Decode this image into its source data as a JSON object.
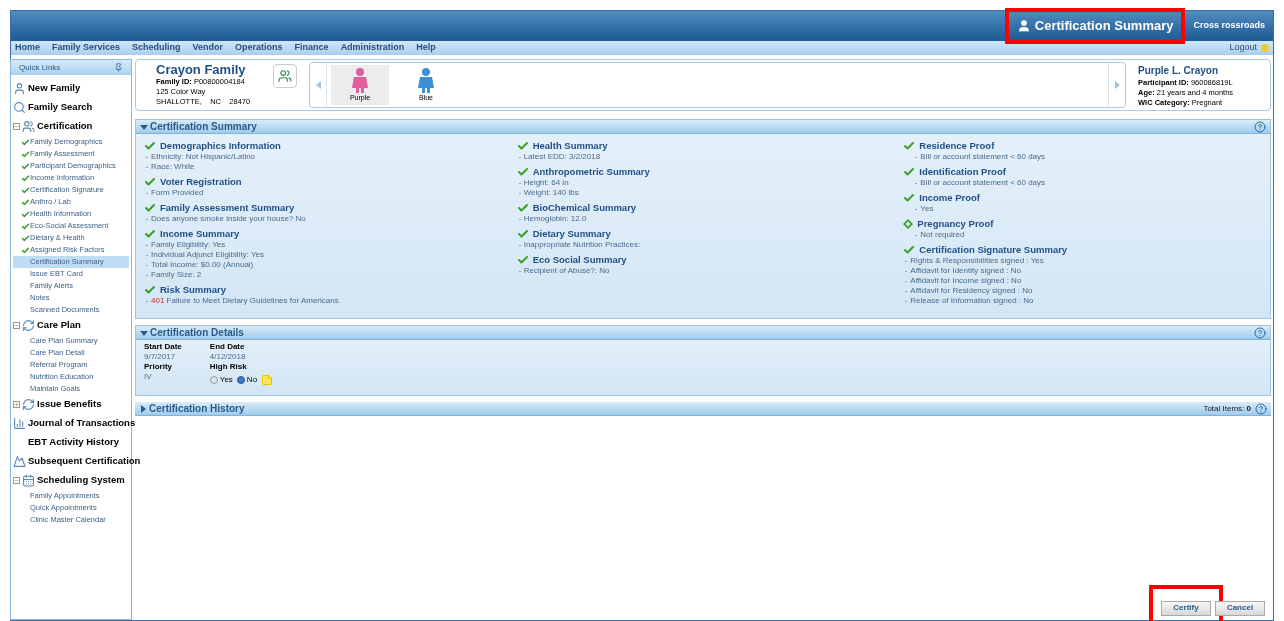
{
  "header": {
    "title": "Certification Summary",
    "highlighted": true,
    "location": "Cross rossroads"
  },
  "menu": [
    "Home",
    "Family Services",
    "Scheduling",
    "Vendor",
    "Operations",
    "Finance",
    "Administration",
    "Help"
  ],
  "logout": "Logout",
  "sidebar": {
    "title": "Quick Links",
    "items": [
      {
        "kind": "link",
        "label": "New Family"
      },
      {
        "kind": "link",
        "label": "Family Search"
      },
      {
        "kind": "section",
        "label": "Certification",
        "expanded": true,
        "children": [
          {
            "label": "Family Demographics",
            "done": true,
            "selected": false
          },
          {
            "label": "Family Assessment",
            "done": true,
            "selected": false
          },
          {
            "label": "Participant Demographics",
            "done": true,
            "selected": false
          },
          {
            "label": "Income Information",
            "done": true,
            "selected": false
          },
          {
            "label": "Certification Signature",
            "done": true,
            "selected": false
          },
          {
            "label": "Anthro / Lab",
            "done": true,
            "selected": false
          },
          {
            "label": "Health Information",
            "done": true,
            "selected": false
          },
          {
            "label": "Eco-Social Assessment",
            "done": true,
            "selected": false
          },
          {
            "label": "Dietary & Health",
            "done": true,
            "selected": false
          },
          {
            "label": "Assigned Risk Factors",
            "done": true,
            "selected": false
          },
          {
            "label": "Certification Summary",
            "done": false,
            "selected": true
          },
          {
            "label": "Issue EBT Card",
            "done": false,
            "selected": false
          },
          {
            "label": "Family Alerts",
            "done": false,
            "selected": false
          },
          {
            "label": "Notes",
            "done": false,
            "selected": false
          },
          {
            "label": "Scanned Documents",
            "done": false,
            "selected": false
          }
        ]
      },
      {
        "kind": "section",
        "label": "Care Plan",
        "expanded": true,
        "children": [
          {
            "label": "Care Plan Summary",
            "done": false,
            "selected": false
          },
          {
            "label": "Care Plan Detail",
            "done": false,
            "selected": false
          },
          {
            "label": "Referral Program",
            "done": false,
            "selected": false
          },
          {
            "label": "Nutrition Education",
            "done": false,
            "selected": false
          },
          {
            "label": "Maintain Goals",
            "done": false,
            "selected": false
          }
        ]
      },
      {
        "kind": "section",
        "label": "Issue Benefits",
        "expanded": false
      },
      {
        "kind": "link",
        "label": "Journal of Transactions"
      },
      {
        "kind": "link",
        "label": "EBT Activity History"
      },
      {
        "kind": "link",
        "label": "Subsequent Certification"
      },
      {
        "kind": "section",
        "label": "Scheduling System",
        "expanded": true,
        "children": [
          {
            "label": "Family Appointments",
            "done": false,
            "selected": false
          },
          {
            "label": "Quick Appointments",
            "done": false,
            "selected": false
          },
          {
            "label": "Clinic Master Calendar",
            "done": false,
            "selected": false
          }
        ]
      }
    ]
  },
  "family": {
    "name": "Crayon Family",
    "id_label": "Family ID:",
    "id": "P00800004184",
    "address": [
      "125 Color Way",
      "SHALLOTTE,    NC    28470"
    ]
  },
  "participants": [
    {
      "name": "Purple",
      "color": "#e35d9c",
      "selected": true
    },
    {
      "name": "Blue",
      "color": "#3a8fd6",
      "selected": false
    }
  ],
  "participant": {
    "name": "Purple L. Crayon",
    "fields": [
      {
        "label": "Participant ID:",
        "value": "960086819L"
      },
      {
        "label": "Age:",
        "value": "21 years and 4 months"
      },
      {
        "label": "WIC Category:",
        "value": "Pregnant"
      }
    ]
  },
  "summary": {
    "title": "Certification Summary",
    "expanded": true,
    "columns": [
      [
        {
          "title": "Demographics Information",
          "done": true,
          "lines": [
            "Ethnicity: Not Hispanic/Latino",
            "Race: White"
          ]
        },
        {
          "title": "Voter Registration",
          "done": true,
          "lines": [
            "Form Provided"
          ]
        },
        {
          "title": "Family Assessment Summary",
          "done": true,
          "lines": [
            "Does anyone smoke inside your house? No"
          ]
        },
        {
          "title": "Income Summary",
          "done": true,
          "lines": [
            "Family Eligibility: Yes",
            "Individual Adjunct Eligibility: Yes",
            "Total Income: $0.00 (Annual)",
            "Family Size: 2"
          ]
        },
        {
          "title": "Risk Summary",
          "done": true,
          "lines": [
            {
              "code": "401",
              "text": "Failure to Meet Dietary Guidelines for Americans"
            }
          ]
        }
      ],
      [
        {
          "title": "Health Summary",
          "done": true,
          "lines": [
            "Latest EDD: 3/2/2018"
          ]
        },
        {
          "title": "Anthropometric Summary",
          "done": true,
          "lines": [
            "Height: 64 in",
            "Weight: 140 lbs"
          ]
        },
        {
          "title": "BioChemical Summary",
          "done": true,
          "lines": [
            "Hemoglobin: 12.0"
          ]
        },
        {
          "title": "Dietary Summary",
          "done": true,
          "lines": [
            "Inappropriate Nutrition Practices:"
          ]
        },
        {
          "title": "Eco Social Summary",
          "done": true,
          "lines": [
            "Recipient of Abuse?: No"
          ]
        }
      ],
      [
        {
          "title": "Residence Proof",
          "done": true,
          "lines": [
            "Bill or account statement < 60 days"
          ]
        },
        {
          "title": "Identification Proof",
          "done": true,
          "lines": [
            "Bill or account statement < 60 days"
          ]
        },
        {
          "title": "Income Proof",
          "done": true,
          "lines": [
            "Yes"
          ]
        },
        {
          "title": "Pregnancy Proof",
          "done": false,
          "lines": [
            "Not required"
          ]
        },
        {
          "title": "Certification Signature Summary",
          "done": true,
          "lines": [
            "Rights & Responsibilities signed : Yes",
            "Affidavit for Identity signed : No",
            "Affidavit for Income signed : No",
            "Affidavit for Residency signed : No",
            "Release of Information signed : No"
          ]
        }
      ]
    ]
  },
  "details": {
    "title": "Certification Details",
    "expanded": true,
    "start_label": "Start Date",
    "start": "9/7/2017",
    "end_label": "End Date",
    "end": "4/12/2018",
    "priority_label": "Priority",
    "priority": "IV",
    "risk_label": "High Risk",
    "risk_options": [
      {
        "label": "Yes",
        "selected": false
      },
      {
        "label": "No",
        "selected": true
      }
    ]
  },
  "history": {
    "title": "Certification History",
    "expanded": false,
    "total_label": "Total Items:",
    "total": "0"
  },
  "buttons": [
    {
      "label": "Certify",
      "highlighted": true
    },
    {
      "label": "Cancel",
      "highlighted": false
    }
  ]
}
